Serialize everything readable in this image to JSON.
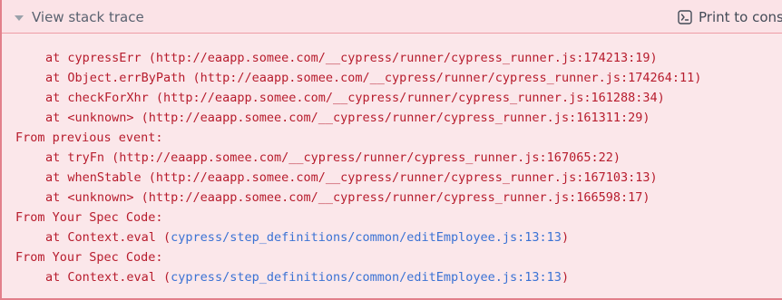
{
  "header": {
    "toggle_label": "View stack trace",
    "print_label": "Print to cons",
    "caret_icon": "caret-down-icon",
    "print_icon": "terminal-icon"
  },
  "colors": {
    "panel_bg": "#fbe7ea",
    "border": "#e2808b",
    "error_text": "#b71c2d",
    "link": "#3a72d4"
  },
  "trace": [
    {
      "prefix": "at cypressErr (http://eaapp.somee.com/__cypress/runner/cypress_runner.js:174213:19)",
      "indent": true
    },
    {
      "prefix": "at Object.errByPath (http://eaapp.somee.com/__cypress/runner/cypress_runner.js:174264:11)",
      "indent": true
    },
    {
      "prefix": "at checkForXhr (http://eaapp.somee.com/__cypress/runner/cypress_runner.js:161288:34)",
      "indent": true
    },
    {
      "prefix": "at <unknown> (http://eaapp.somee.com/__cypress/runner/cypress_runner.js:161311:29)",
      "indent": true
    },
    {
      "prefix": "From previous event:",
      "indent": false
    },
    {
      "prefix": "at tryFn (http://eaapp.somee.com/__cypress/runner/cypress_runner.js:167065:22)",
      "indent": true
    },
    {
      "prefix": "at whenStable (http://eaapp.somee.com/__cypress/runner/cypress_runner.js:167103:13)",
      "indent": true
    },
    {
      "prefix": "at <unknown> (http://eaapp.somee.com/__cypress/runner/cypress_runner.js:166598:17)",
      "indent": true
    },
    {
      "prefix": "From Your Spec Code:",
      "indent": false
    },
    {
      "prefix": "at Context.eval (",
      "link": "cypress/step_definitions/common/editEmployee.js:13:13",
      "suffix": ")",
      "indent": true
    },
    {
      "prefix": "From Your Spec Code:",
      "indent": false
    },
    {
      "prefix": "at Context.eval (",
      "link": "cypress/step_definitions/common/editEmployee.js:13:13",
      "suffix": ")",
      "indent": true
    }
  ]
}
